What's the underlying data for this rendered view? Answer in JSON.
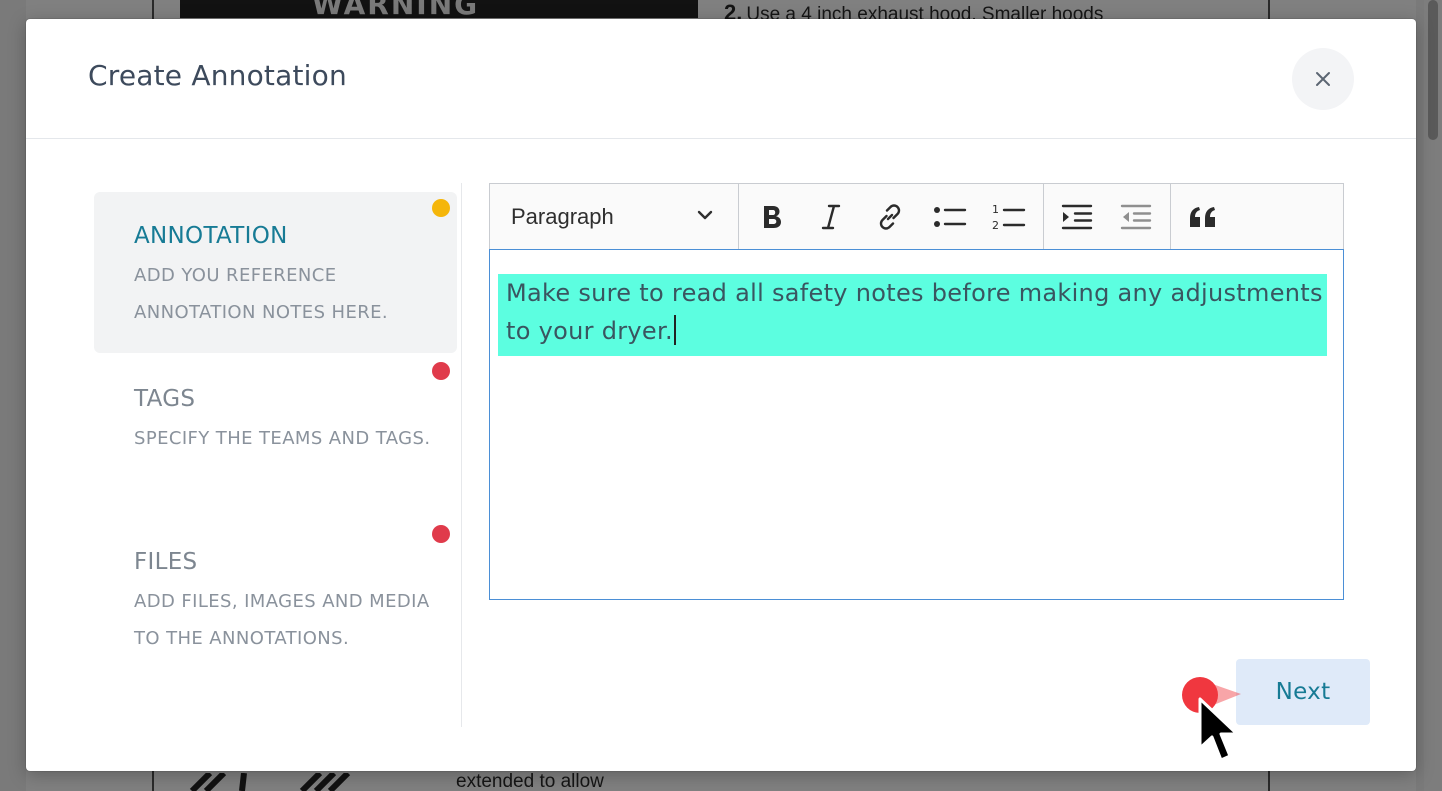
{
  "background_document": {
    "warning_label": "WARNING",
    "top_text_number": "2.",
    "top_text": "Use a 4 inch exhaust hood. Smaller hoods",
    "bottom_text": "extended to allow"
  },
  "modal": {
    "title": "Create Annotation",
    "close_icon": "close-icon"
  },
  "steps": [
    {
      "title": "ANNOTATION",
      "description": "ADD YOU REFERENCE ANNOTATION NOTES HERE.",
      "status_color": "#f5b60a",
      "active": true
    },
    {
      "title": "TAGS",
      "description": "SPECIFY THE TEAMS AND TAGS.",
      "status_color": "#e03b4b",
      "active": false
    },
    {
      "title": "FILES",
      "description": "ADD FILES, IMAGES AND MEDIA TO THE ANNOTATIONS.",
      "status_color": "#e03b4b",
      "active": false
    }
  ],
  "editor": {
    "block_format": "Paragraph",
    "toolbar_icons": [
      "bold-icon",
      "italic-icon",
      "link-icon",
      "bulleted-list-icon",
      "numbered-list-icon",
      "indent-icon",
      "outdent-icon",
      "block-quote-icon"
    ],
    "content": "Make sure to read all safety notes before making any adjustments to your dryer.",
    "highlight_color": "#5cfee0"
  },
  "actions": {
    "next_label": "Next"
  },
  "colors": {
    "accent_text": "#177b95",
    "title_text": "#3d4a5c",
    "muted_text": "#8a929c",
    "next_bg": "#dfeaf9",
    "click_indicator": "#f0373f"
  }
}
